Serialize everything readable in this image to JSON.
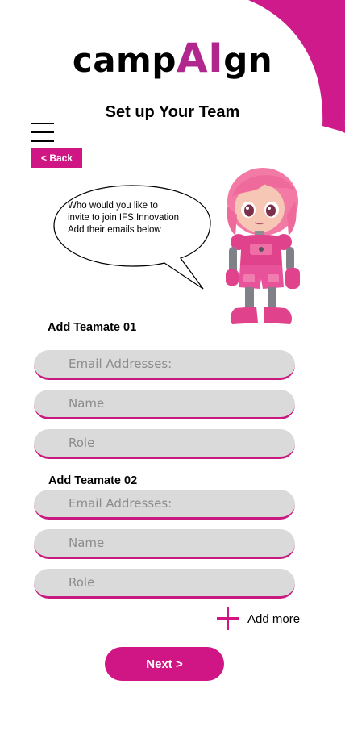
{
  "brand": {
    "prefix": "camp",
    "highlight": "AI",
    "suffix": "gn",
    "highlight_color": "#b1278e"
  },
  "page_title": "Set up Your Team",
  "nav": {
    "menu_icon": "hamburger-icon",
    "back_label": "< Back"
  },
  "assistant": {
    "speech_lines": [
      "Who would you like to",
      " invite to join IFS Innovation",
      " Add their emails below"
    ],
    "mascot": "pink-robot-girl"
  },
  "teammates": [
    {
      "heading": "Add Teamate 01",
      "fields": {
        "email_placeholder": "Email Addresses:",
        "name_placeholder": "Name",
        "role_placeholder": "Role"
      }
    },
    {
      "heading": "Add Teamate 02",
      "fields": {
        "email_placeholder": "Email Addresses:",
        "name_placeholder": "Name",
        "role_placeholder": "Role"
      }
    }
  ],
  "add_more": {
    "icon": "plus-icon",
    "label": "Add more"
  },
  "next_label": "Next >",
  "colors": {
    "accent": "#d01685",
    "input_bg": "#dadada",
    "input_underline": "#c7197f"
  }
}
